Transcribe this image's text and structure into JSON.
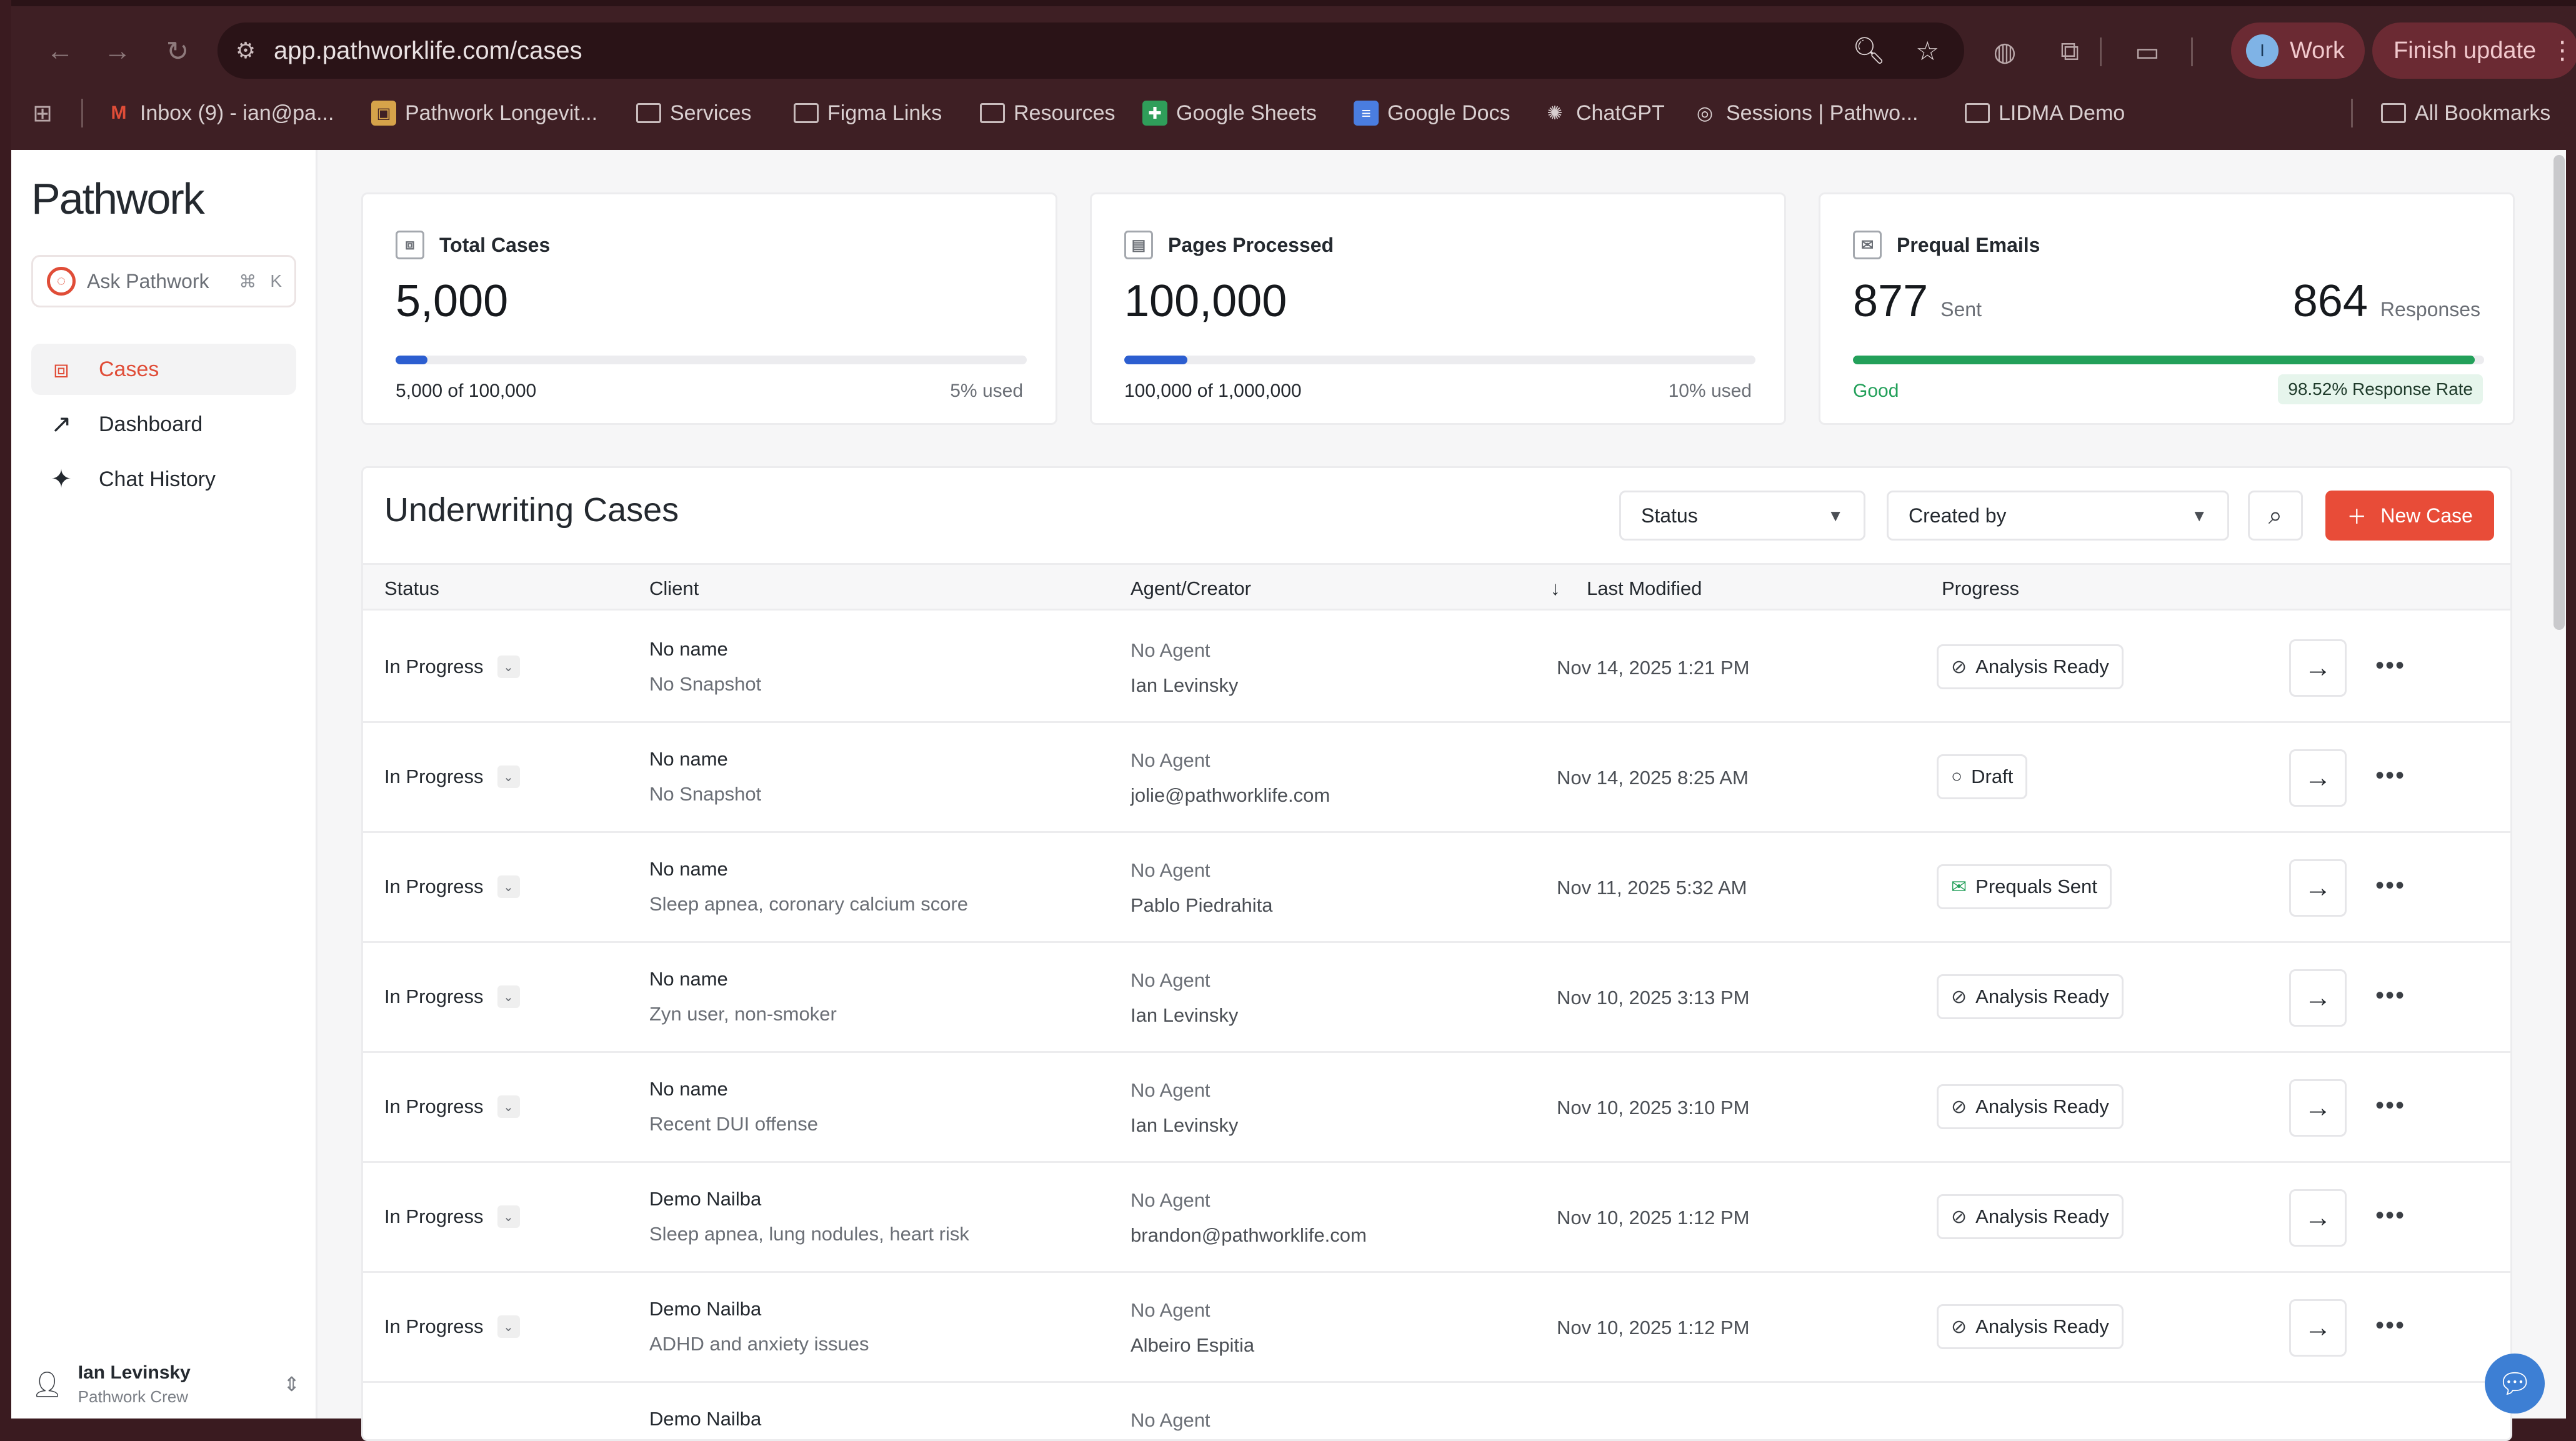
{
  "browser": {
    "url": "app.pathworklife.com/cases",
    "profile_label": "Work",
    "profile_initial": "I",
    "update_label": "Finish update",
    "bookmarks": [
      {
        "label": "Inbox (9) - ian@pa...",
        "icon": "gmail-icon"
      },
      {
        "label": "Pathwork Longevit...",
        "icon": "image-bookmark-icon"
      },
      {
        "label": "Services",
        "icon": "folder-icon"
      },
      {
        "label": "Figma Links",
        "icon": "folder-icon"
      },
      {
        "label": "Resources",
        "icon": "folder-icon"
      },
      {
        "label": "Google Sheets",
        "icon": "sheets-icon"
      },
      {
        "label": "Google Docs",
        "icon": "docs-icon"
      },
      {
        "label": "ChatGPT",
        "icon": "chatgpt-icon"
      },
      {
        "label": "Sessions | Pathwo...",
        "icon": "pathwork-icon"
      },
      {
        "label": "LIDMA Demo",
        "icon": "folder-icon"
      }
    ],
    "all_bookmarks_label": "All Bookmarks"
  },
  "sidebar": {
    "logo": "Pathwork",
    "ask_label": "Ask Pathwork",
    "ask_shortcut_cmd": "⌘",
    "ask_shortcut_key": "K",
    "items": [
      {
        "label": "Cases",
        "icon": "briefcase-icon",
        "active": true
      },
      {
        "label": "Dashboard",
        "icon": "trend-icon",
        "active": false
      },
      {
        "label": "Chat History",
        "icon": "sparkle-icon",
        "active": false
      }
    ],
    "user": {
      "name": "Ian Levinsky",
      "team": "Pathwork Crew"
    }
  },
  "stats": {
    "total_cases": {
      "title": "Total Cases",
      "value": "5,000",
      "footer_left": "5,000 of 100,000",
      "footer_right": "5% used",
      "percent": 5
    },
    "pages_processed": {
      "title": "Pages Processed",
      "value": "100,000",
      "footer_left": "100,000 of 1,000,000",
      "footer_right": "10% used",
      "percent": 10
    },
    "prequal_emails": {
      "title": "Prequal Emails",
      "sent_value": "877",
      "sent_label": "Sent",
      "responses_value": "864",
      "responses_label": "Responses",
      "quality": "Good",
      "rate": "98.52% Response Rate",
      "percent": 98.52
    }
  },
  "cases": {
    "title": "Underwriting Cases",
    "status_filter": "Status",
    "created_by_filter": "Created by",
    "new_case_label": "New Case",
    "columns": {
      "status": "Status",
      "client": "Client",
      "agent": "Agent/Creator",
      "last_modified": "Last Modified",
      "progress": "Progress"
    },
    "rows": [
      {
        "status": "In Progress",
        "client_name": "No name",
        "client_note": "No Snapshot",
        "agent": "No Agent",
        "creator": "Ian Levinsky",
        "modified": "Nov 14, 2025 1:21 PM",
        "progress": "Analysis Ready",
        "progress_icon": "analysis-icon"
      },
      {
        "status": "In Progress",
        "client_name": "No name",
        "client_note": "No Snapshot",
        "agent": "No Agent",
        "creator": "jolie@pathworklife.com",
        "modified": "Nov 14, 2025 8:25 AM",
        "progress": "Draft",
        "progress_icon": "draft-circle-icon"
      },
      {
        "status": "In Progress",
        "client_name": "No name",
        "client_note": "Sleep apnea, coronary calcium score",
        "agent": "No Agent",
        "creator": "Pablo Piedrahita",
        "modified": "Nov 11, 2025 5:32 AM",
        "progress": "Prequals Sent",
        "progress_icon": "mail-icon"
      },
      {
        "status": "In Progress",
        "client_name": "No name",
        "client_note": "Zyn user, non-smoker",
        "agent": "No Agent",
        "creator": "Ian Levinsky",
        "modified": "Nov 10, 2025 3:13 PM",
        "progress": "Analysis Ready",
        "progress_icon": "analysis-icon"
      },
      {
        "status": "In Progress",
        "client_name": "No name",
        "client_note": "Recent DUI offense",
        "agent": "No Agent",
        "creator": "Ian Levinsky",
        "modified": "Nov 10, 2025 3:10 PM",
        "progress": "Analysis Ready",
        "progress_icon": "analysis-icon"
      },
      {
        "status": "In Progress",
        "client_name": "Demo Nailba",
        "client_note": "Sleep apnea, lung nodules, heart risk",
        "agent": "No Agent",
        "creator": "brandon@pathworklife.com",
        "modified": "Nov 10, 2025 1:12 PM",
        "progress": "Analysis Ready",
        "progress_icon": "analysis-icon"
      },
      {
        "status": "In Progress",
        "client_name": "Demo Nailba",
        "client_note": "ADHD and anxiety issues",
        "agent": "No Agent",
        "creator": "Albeiro Espitia",
        "modified": "Nov 10, 2025 1:12 PM",
        "progress": "Analysis Ready",
        "progress_icon": "analysis-icon"
      },
      {
        "status": "",
        "client_name": "Demo Nailba",
        "client_note": "",
        "agent": "No Agent",
        "creator": "",
        "modified": "",
        "progress": "",
        "progress_icon": ""
      }
    ]
  },
  "colors": {
    "accent": "#e84c38",
    "progress_blue": "#2c5ed0",
    "good_green": "#23a05a"
  }
}
